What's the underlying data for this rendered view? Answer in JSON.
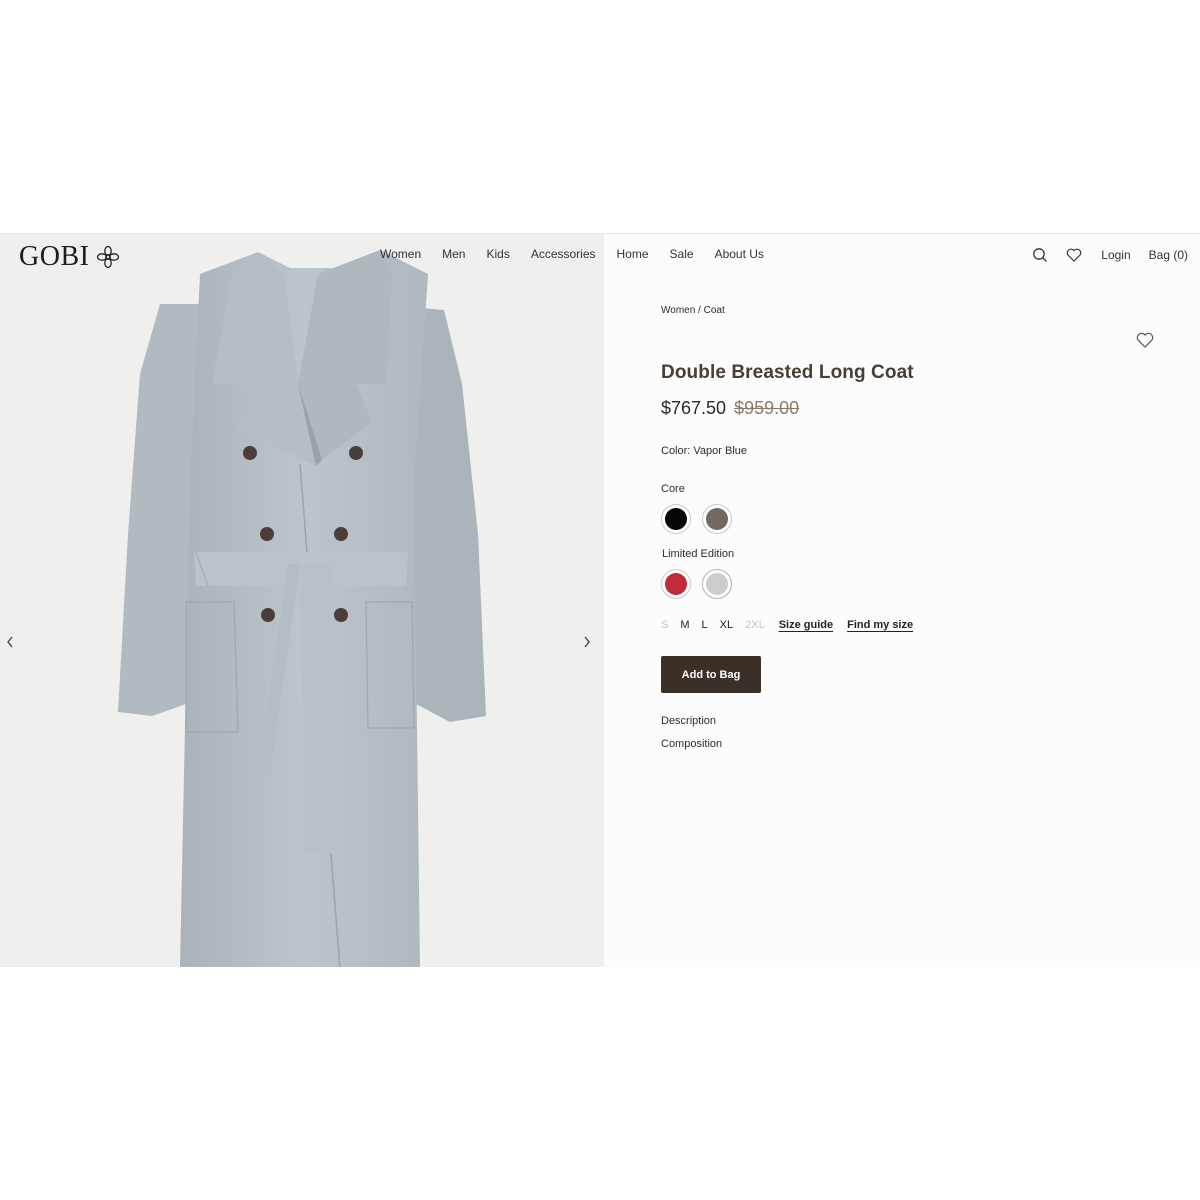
{
  "header": {
    "brand": "GOBI",
    "nav": [
      "Women",
      "Men",
      "Kids",
      "Accessories",
      "Home",
      "Sale",
      "About Us"
    ],
    "login": "Login",
    "bag": "Bag (0)"
  },
  "product": {
    "breadcrumb": "Women / Coat",
    "title": "Double Breasted Long Coat",
    "sale_price": "$767.50",
    "original_price": "$959.00",
    "color_label": "Color: Vapor Blue",
    "core_label": "Core",
    "core_swatches": [
      {
        "name": "black",
        "color": "#050505"
      },
      {
        "name": "taupe",
        "color": "#75695f"
      }
    ],
    "limited_label": "Limited Edition",
    "limited_swatches": [
      {
        "name": "red",
        "color": "#c22a3b"
      },
      {
        "name": "light-grey",
        "color": "#cdcbcb"
      }
    ],
    "sizes": [
      {
        "label": "S",
        "available": false
      },
      {
        "label": "M",
        "available": true
      },
      {
        "label": "L",
        "available": true
      },
      {
        "label": "XL",
        "available": true
      },
      {
        "label": "2XL",
        "available": false
      }
    ],
    "size_guide": "Size guide",
    "find_my_size": "Find my size",
    "add_to_bag": "Add to Bag",
    "description": "Description",
    "composition": "Composition"
  },
  "colors": {
    "accent": "#3b3028",
    "title": "#4a3d33",
    "coat": "#b7c1c6"
  },
  "icons": {
    "search": "search-icon",
    "wishlist": "heart-icon",
    "prev": "chevron-left-icon",
    "next": "chevron-right-icon"
  }
}
